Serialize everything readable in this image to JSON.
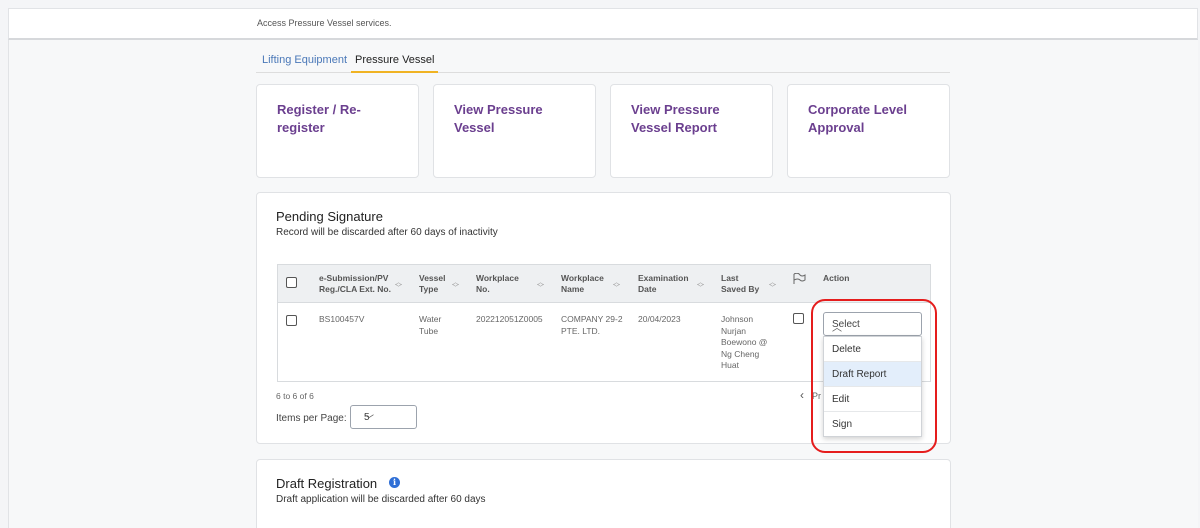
{
  "header": {
    "subtitle": "Access Pressure Vessel services."
  },
  "tabs": [
    {
      "label": "Lifting Equipment"
    },
    {
      "label": "Pressure Vessel"
    }
  ],
  "cards": [
    {
      "label_line1": "Register / Re-",
      "label_line2": "register"
    },
    {
      "label_line1": "View Pressure",
      "label_line2": "Vessel"
    },
    {
      "label_line1": "View Pressure",
      "label_line2": "Vessel Report"
    },
    {
      "label_line1": "Corporate Level",
      "label_line2": "Approval"
    }
  ],
  "pending": {
    "title": "Pending Signature",
    "subtitle": "Record will be discarded after 60 days of inactivity",
    "columns": [
      {
        "l1": "e-Submission/PV",
        "l2": "Reg./CLA Ext. No."
      },
      {
        "l1": "Vessel",
        "l2": "Type"
      },
      {
        "l1": "Workplace",
        "l2": "No."
      },
      {
        "l1": "Workplace",
        "l2": "Name"
      },
      {
        "l1": "Examination",
        "l2": "Date"
      },
      {
        "l1": "Last",
        "l2": "Saved By"
      },
      {
        "l1": "Action",
        "l2": ""
      }
    ],
    "row": {
      "submission_no": "BS100457V",
      "vessel_type_l1": "Water",
      "vessel_type_l2": "Tube",
      "workplace_no": "202212051Z0005",
      "workplace_name_l1": "COMPANY 29-2",
      "workplace_name_l2": "PTE. LTD.",
      "exam_date": "20/04/2023",
      "saved_by": [
        "Johnson",
        "Nurjan",
        "Boewono @",
        "Ng Cheng",
        "Huat"
      ]
    },
    "action_select": {
      "value": "Select",
      "options": [
        "Delete",
        "Draft Report",
        "Edit",
        "Sign"
      ],
      "highlighted": "Draft Report"
    },
    "range_text": "6 to 6 of 6",
    "items_per_page_label": "Items per Page:",
    "items_per_page_value": "5",
    "prev_partial": "Pr"
  },
  "draft": {
    "title": "Draft Registration",
    "subtitle": "Draft application will be discarded after 60 days"
  },
  "colors": {
    "accent_purple": "#6b3f8f",
    "tab_link_blue": "#4a78b8",
    "tab_active_underline": "#f0b323",
    "highlight_red": "#e51d1d",
    "info_blue": "#2f6fd6"
  }
}
